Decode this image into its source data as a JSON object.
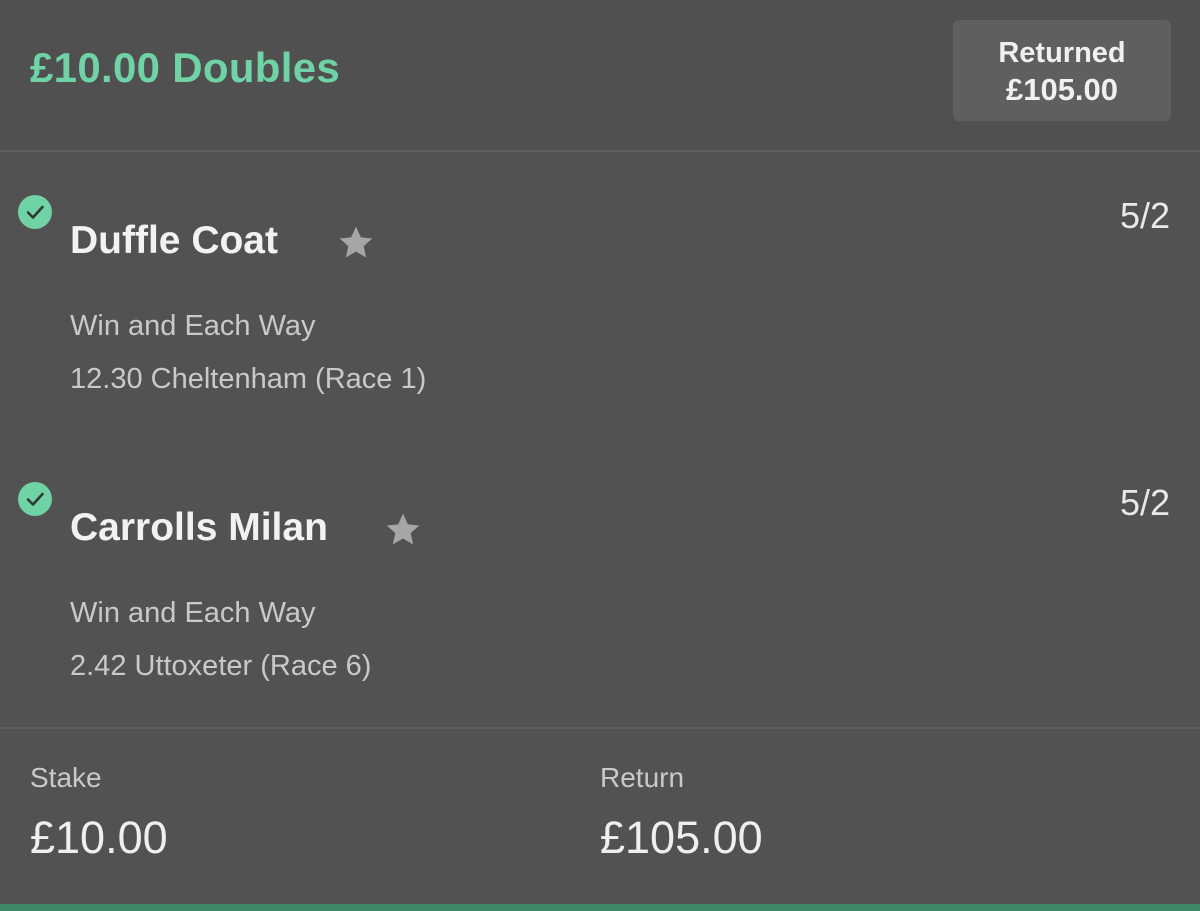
{
  "bet": {
    "title": "£10.00 Doubles",
    "returned_label": "Returned",
    "returned_amount": "£105.00"
  },
  "selections": [
    {
      "status_icon": "check-circle-icon",
      "name": "Duffle Coat",
      "favourite_icon": "star-icon",
      "odds": "5/2",
      "market": "Win and Each Way",
      "event": "12.30 Cheltenham (Race 1)"
    },
    {
      "status_icon": "check-circle-icon",
      "name": "Carrolls Milan",
      "favourite_icon": "star-icon",
      "odds": "5/2",
      "market": "Win and Each Way",
      "event": "2.42 Uttoxeter (Race 6)"
    }
  ],
  "summary": {
    "stake_label": "Stake",
    "stake_value": "£10.00",
    "return_label": "Return",
    "return_value": "£105.00"
  },
  "colors": {
    "background": "#525252",
    "accent_green": "#6fd3a6",
    "bottom_bar": "#3f8a66",
    "star_grey": "#a6a6a6"
  }
}
